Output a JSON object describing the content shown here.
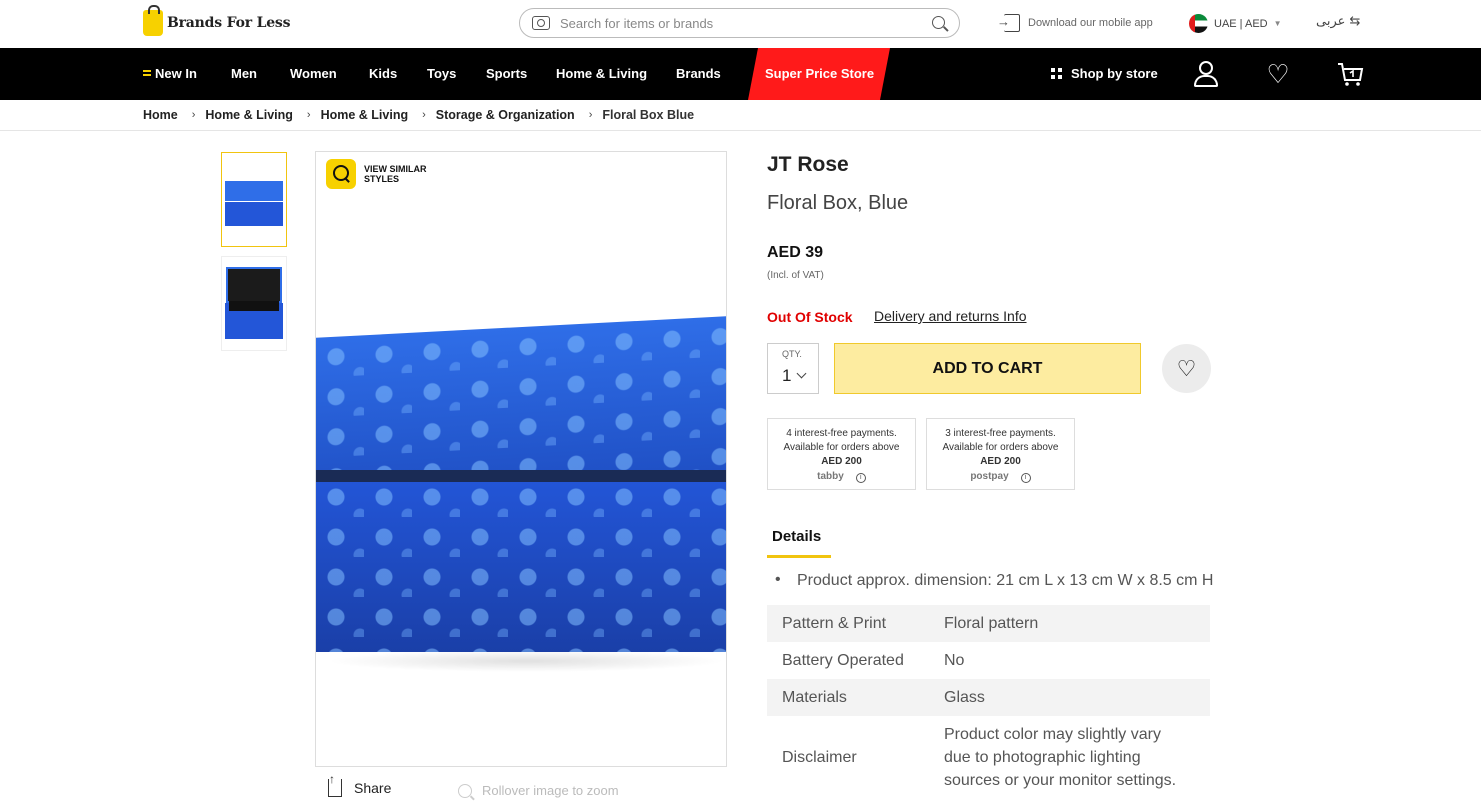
{
  "header": {
    "logo_text": "Brands For Less",
    "search_placeholder": "Search for items or brands",
    "download_label": "Download our mobile app",
    "country_label": "UAE | AED",
    "language_label": "عربى ⇆"
  },
  "nav": {
    "items": [
      "New In",
      "Men",
      "Women",
      "Kids",
      "Toys",
      "Sports",
      "Home & Living",
      "Brands"
    ],
    "super_label": "Super Price Store",
    "shop_by_store": "Shop by store"
  },
  "breadcrumb": [
    "Home",
    "Home & Living",
    "Home & Living",
    "Storage & Organization",
    "Floral Box Blue"
  ],
  "gallery": {
    "view_similar": "VIEW SIMILAR STYLES",
    "share_label": "Share",
    "zoom_hint": "Rollover image to zoom"
  },
  "product": {
    "brand": "JT Rose",
    "name": "Floral Box, Blue",
    "price": "AED 39",
    "vat_note": "(Incl. of VAT)",
    "stock_status": "Out Of Stock",
    "delivery_link": "Delivery and returns Info",
    "qty_label": "QTY.",
    "qty_value": "1",
    "add_to_cart": "ADD TO CART"
  },
  "payments": [
    {
      "line1": "4 interest-free payments.",
      "line2": "Available for orders above",
      "amount": "AED 200",
      "provider": "tabby"
    },
    {
      "line1": "3 interest-free payments.",
      "line2": "Available for orders above",
      "amount": "AED 200",
      "provider": "postpay"
    }
  ],
  "details": {
    "tab_label": "Details",
    "bullet": "Product approx. dimension: 21 cm L x 13 cm W x 8.5 cm H",
    "attributes": [
      {
        "key": "Pattern & Print",
        "value": "Floral pattern"
      },
      {
        "key": "Battery Operated",
        "value": "No"
      },
      {
        "key": "Materials",
        "value": "Glass"
      },
      {
        "key": "Disclaimer",
        "value": "Product color may slightly vary due to photographic lighting sources or your monitor settings."
      }
    ]
  },
  "colors": {
    "accent_yellow": "#f7d100",
    "super_red": "#ff1a1a",
    "oos_red": "#e00000",
    "cart_bg": "#fdeca0"
  }
}
